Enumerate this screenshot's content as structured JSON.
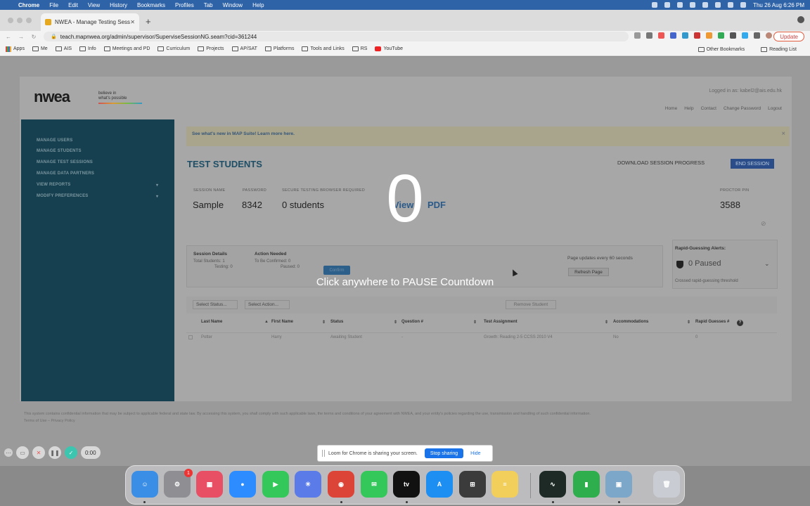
{
  "menubar": {
    "app": "Chrome",
    "items": [
      "File",
      "Edit",
      "View",
      "History",
      "Bookmarks",
      "Profiles",
      "Tab",
      "Window",
      "Help"
    ],
    "clock": "Thu 26 Aug  6:26 PM"
  },
  "browser": {
    "tab_title": "NWEA - Manage Testing Sessi",
    "url": "teach.mapnwea.org/admin/supervisor/SuperviseSessionNG.seam?cid=361244",
    "update_label": "Update",
    "bookmarks": [
      "Apps",
      "Me",
      "AIS",
      "Info",
      "Meetings and PD",
      "Curriculum",
      "Projects",
      "AP/SAT",
      "Platforms",
      "Tools and Links",
      "RS",
      "YouTube"
    ],
    "bookmarks_right": [
      "Other Bookmarks",
      "Reading List"
    ]
  },
  "nwea": {
    "logo": "nwea",
    "tagline_line1": "believe in",
    "tagline_line2": "what's possible",
    "logged_in": "Logged in as: kabel2@ais.edu.hk",
    "top_links": [
      "Home",
      "Help",
      "Contact",
      "Change Password",
      "Logout"
    ],
    "sidebar": [
      {
        "label": "MANAGE USERS",
        "arrow": ""
      },
      {
        "label": "MANAGE STUDENTS",
        "arrow": ""
      },
      {
        "label": "MANAGE TEST SESSIONS",
        "arrow": ""
      },
      {
        "label": "MANAGE DATA PARTNERS",
        "arrow": ""
      },
      {
        "label": "VIEW REPORTS",
        "arrow": "▾"
      },
      {
        "label": "MODIFY PREFERENCES",
        "arrow": "▾"
      }
    ],
    "banner": "See what's new in MAP Suite! Learn more here.",
    "page_title": "TEST STUDENTS",
    "download_label": "DOWNLOAD SESSION PROGRESS",
    "end_session_label": "END SESSION",
    "session": {
      "name_label": "SESSION NAME",
      "name_value": "Sample",
      "password_label": "PASSWORD",
      "password_value": "8342",
      "browser_label": "SECURE TESTING BROWSER REQUIRED",
      "browser_value": "0 students",
      "view_value": "View",
      "pdf_value": "PDF",
      "proctor_label": "PROCTOR PIN",
      "proctor_value": "3588"
    },
    "details": {
      "title": "Session Details",
      "total": "Total Students: 1",
      "testing": "Testing: 0",
      "action_title": "Action Needed",
      "to_confirm": "To Be Confirmed: 0",
      "paused": "Paused: 0",
      "confirm_label": "Confirm",
      "page_updates": "Page updates every 60 seconds",
      "refresh_label": "Refresh Page"
    },
    "rapid": {
      "title": "Rapid-Guessing Alerts:",
      "paused": "0 Paused",
      "sub": "Crossed rapid-guessing threshold"
    },
    "filters": {
      "status": "Select Status...",
      "action": "Select Action...",
      "remove": "Remove Student"
    },
    "columns": [
      "Last Name",
      "First Name",
      "Status",
      "Question #",
      "Test Assignment",
      "Accommodations",
      "Rapid Guesses #"
    ],
    "rows": [
      {
        "last": "Potter",
        "first": "Harry",
        "status": "Awaiting Student",
        "question": "-",
        "assignment": "Growth: Reading 2-5 CCSS 2010 V4",
        "accommodations": "No",
        "rapid": "0"
      }
    ],
    "footer_line1": "This system contains confidential information that may be subject to applicable federal and state law. By accessing this system, you shall comply with such applicable laws, the terms and conditions of your agreement with NWEA, and your entity's policies regarding the use, transmission and handling of such confidential information.",
    "footer_links": "Terms of Use  –  Privacy Policy"
  },
  "overlay": {
    "countdown": "0",
    "message": "Click anywhere to PAUSE Countdown"
  },
  "loom": {
    "timer": "0:00",
    "share_text": "Loom for Chrome is sharing your screen.",
    "stop_label": "Stop sharing",
    "hide_label": "Hide"
  },
  "dock": [
    {
      "name": "Finder",
      "glyph": "☺",
      "color": "#3a8ee6"
    },
    {
      "name": "System Preferences",
      "glyph": "⚙",
      "color": "#8e8e93",
      "badge": "1"
    },
    {
      "name": "Launchpad",
      "glyph": "▦",
      "color": "#e94f64"
    },
    {
      "name": "Zoom",
      "glyph": "●",
      "color": "#2d8cff"
    },
    {
      "name": "FaceTime",
      "glyph": "▶",
      "color": "#34c759"
    },
    {
      "name": "Perplexity",
      "glyph": "✳",
      "color": "#5a7be8"
    },
    {
      "name": "Chrome",
      "glyph": "◉",
      "color": "#dc4437"
    },
    {
      "name": "Messages",
      "glyph": "✉",
      "color": "#34c759"
    },
    {
      "name": "Apple TV",
      "glyph": "tv",
      "color": "#111111"
    },
    {
      "name": "App Store",
      "glyph": "A",
      "color": "#1e8ff2"
    },
    {
      "name": "Calculator",
      "glyph": "⊞",
      "color": "#3b3b3b"
    },
    {
      "name": "Notes",
      "glyph": "≡",
      "color": "#f2cf5b"
    },
    {
      "name": "Activity Monitor",
      "glyph": "∿",
      "color": "#1d2a25"
    },
    {
      "name": "Numbers",
      "glyph": "▮",
      "color": "#2fae4e"
    },
    {
      "name": "Preview",
      "glyph": "▣",
      "color": "#7da7c9"
    },
    {
      "name": "Trash",
      "glyph": "🗑",
      "color": "#c9cdd3"
    }
  ]
}
